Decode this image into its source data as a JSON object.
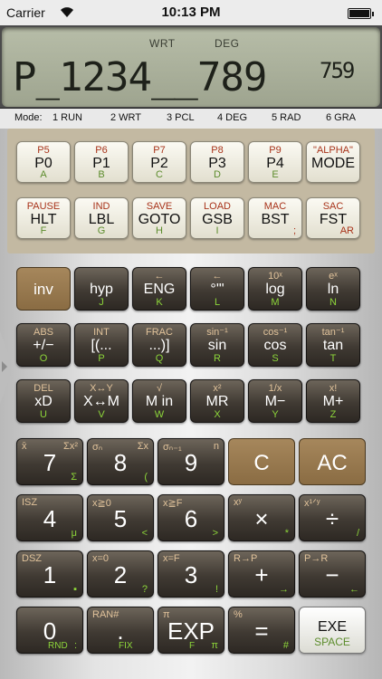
{
  "status": {
    "carrier": "Carrier",
    "time": "10:13 PM"
  },
  "display": {
    "annunciator1": "WRT",
    "annunciator2": "DEG",
    "main": "P_1234__789",
    "exponent": "759"
  },
  "mode_bar": {
    "label": "Mode:",
    "items": [
      "1 RUN",
      "2 WRT",
      "3 PCL",
      "4 DEG",
      "5 RAD",
      "6 GRA"
    ]
  },
  "keys": {
    "r1": [
      {
        "top": "P5",
        "main": "P0",
        "bot": "A"
      },
      {
        "top": "P6",
        "main": "P1",
        "bot": "B"
      },
      {
        "top": "P7",
        "main": "P2",
        "bot": "C"
      },
      {
        "top": "P8",
        "main": "P3",
        "bot": "D"
      },
      {
        "top": "P9",
        "main": "P4",
        "bot": "E"
      },
      {
        "top": "\"ALPHA\"",
        "main": "MODE",
        "bot": ""
      }
    ],
    "r2": [
      {
        "top": "PAUSE",
        "main": "HLT",
        "bot": "F",
        "sub": ""
      },
      {
        "top": "IND",
        "main": "LBL",
        "bot": "G",
        "sub": ""
      },
      {
        "top": "SAVE",
        "main": "GOTO",
        "bot": "H",
        "sub": ""
      },
      {
        "top": "LOAD",
        "main": "GSB",
        "bot": "I",
        "sub": ""
      },
      {
        "top": "MAC",
        "main": "BST",
        "bot": "",
        "sub": ";"
      },
      {
        "top": "SAC",
        "main": "FST",
        "bot": "",
        "sub": "AR"
      }
    ],
    "r3": [
      {
        "top": "",
        "main": "inv",
        "bot": ""
      },
      {
        "top": "",
        "main": "hyp",
        "bot": "J"
      },
      {
        "top": "←",
        "main": "ENG",
        "bot": "K"
      },
      {
        "top": "←",
        "main": "°'\"",
        "bot": "L"
      },
      {
        "top": "10ˣ",
        "main": "log",
        "bot": "M"
      },
      {
        "top": "eˣ",
        "main": "ln",
        "bot": "N"
      }
    ],
    "r4": [
      {
        "top": "ABS",
        "main": "+/−",
        "bot": "O"
      },
      {
        "top": "INT",
        "main": "[(...",
        "bot": "P"
      },
      {
        "top": "FRAC",
        "main": "...)]",
        "bot": "Q"
      },
      {
        "top": "sin⁻¹",
        "main": "sin",
        "bot": "R"
      },
      {
        "top": "cos⁻¹",
        "main": "cos",
        "bot": "S"
      },
      {
        "top": "tan⁻¹",
        "main": "tan",
        "bot": "T"
      }
    ],
    "r5": [
      {
        "top": "DEL",
        "main": "xD",
        "bot": "U"
      },
      {
        "top": "X↔Y",
        "main": "X↔M",
        "bot": "V"
      },
      {
        "top": "√",
        "main": "M in",
        "bot": "W"
      },
      {
        "top": "x²",
        "main": "MR",
        "bot": "X"
      },
      {
        "top": "1/x",
        "main": "M−",
        "bot": "Y"
      },
      {
        "top": "x!",
        "main": "M+",
        "bot": "Z"
      }
    ],
    "r6": [
      {
        "tl": "x̄",
        "tr": "Σx²",
        "main": "7",
        "br": "Σ"
      },
      {
        "tl": "σₙ",
        "tr": "Σx",
        "main": "8",
        "br": "("
      },
      {
        "tl": "σₙ₋₁",
        "tr": "n",
        "main": "9",
        "br": ""
      },
      {
        "tl": "",
        "tr": "",
        "main": "C",
        "br": ""
      },
      {
        "tl": "",
        "tr": "",
        "main": "AC",
        "br": ""
      }
    ],
    "r7": [
      {
        "tl": "ISZ",
        "tr": "",
        "main": "4",
        "br": "μ"
      },
      {
        "tl": "x≧0",
        "tr": "",
        "main": "5",
        "br": "<"
      },
      {
        "tl": "x≧F",
        "tr": "",
        "main": "6",
        "br": ">"
      },
      {
        "tl": "xʸ",
        "tr": "",
        "main": "×",
        "br": "*"
      },
      {
        "tl": "x¹ᐟʸ",
        "tr": "",
        "main": "÷",
        "br": "/"
      }
    ],
    "r8": [
      {
        "tl": "DSZ",
        "tr": "",
        "main": "1",
        "br": "▪"
      },
      {
        "tl": "x=0",
        "tr": "",
        "main": "2",
        "br": "?"
      },
      {
        "tl": "x=F",
        "tr": "",
        "main": "3",
        "br": "!"
      },
      {
        "tl": "R→P",
        "tr": "",
        "main": "+",
        "br": "→"
      },
      {
        "tl": "P→R",
        "tr": "",
        "main": "−",
        "br": "←"
      }
    ],
    "r9": [
      {
        "tl": "",
        "tr": "",
        "main": "0",
        "br": ":",
        "bl": "RND"
      },
      {
        "tl": "RAN#",
        "tr": "",
        "main": ".",
        "br": "",
        "bl": "FIX"
      },
      {
        "tl": "π",
        "tr": "",
        "main": "EXP",
        "br": "π",
        "bl": "F"
      },
      {
        "tl": "%",
        "tr": "",
        "main": "=",
        "br": "#"
      },
      {
        "main": "EXE",
        "bot": "SPACE"
      }
    ]
  }
}
